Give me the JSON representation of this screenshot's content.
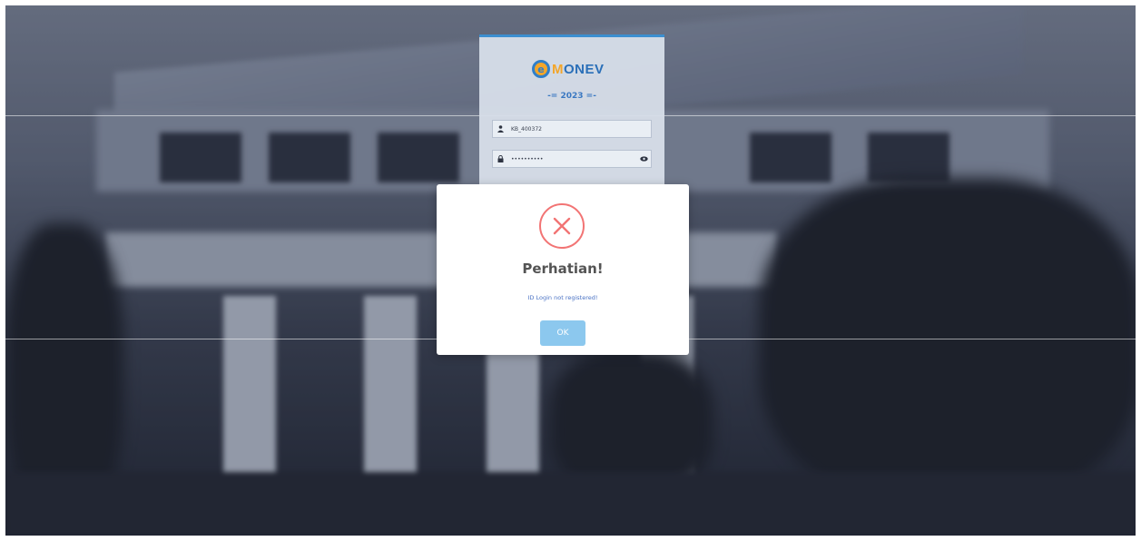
{
  "login": {
    "logo_text_m": "M",
    "logo_text_rest": "ONEV",
    "year_label": "-= 2023 =-",
    "username_value": "KB_400372",
    "password_value": "••••••••••"
  },
  "modal": {
    "title": "Perhatian!",
    "message": "ID Login not registered!",
    "ok_label": "OK"
  },
  "colors": {
    "error": "#f27474",
    "ok_button": "#8cc8ee",
    "brand_blue": "#2f7fc9",
    "brand_orange": "#f3a62a"
  },
  "icons": {
    "user": "user-icon",
    "lock": "lock-icon",
    "eye": "eye-icon",
    "error": "error-x-icon"
  }
}
